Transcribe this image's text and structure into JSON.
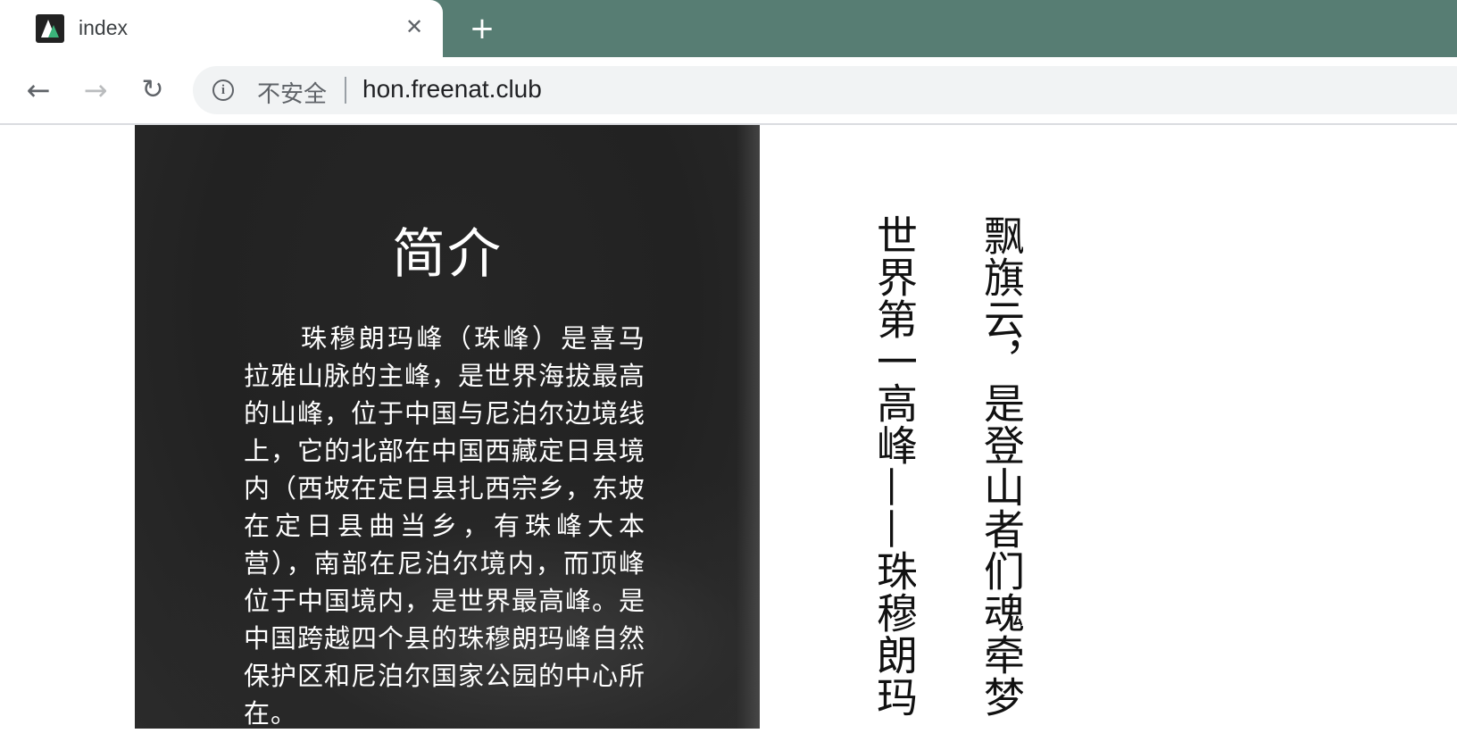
{
  "browser": {
    "tab_title": "index",
    "tab_close": "✕",
    "new_tab": "+",
    "back": "←",
    "forward": "→",
    "reload": "↻",
    "security_label": "不安全",
    "url": "hon.freenat.club",
    "accent_color": "#577d73"
  },
  "intro": {
    "title": "简介",
    "paragraph": "珠穆朗玛峰（珠峰）是喜马拉雅山脉的主峰，是世界海拔最高的山峰，位于中国与尼泊尔边境线上，它的北部在中国西藏定日县境内（西坡在定日县扎西宗乡，东坡在定日县曲当乡，有珠峰大本营），南部在尼泊尔境内，而顶峰位于中国境内，是世界最高峰。是中国跨越四个县的珠穆朗玛峰自然保护区和尼泊尔国家公园的中心所在。"
  },
  "poem": {
    "column_1": "飘旗云，是登山者们魂牵梦",
    "column_2": "世界第一高峰——珠穆朗玛"
  }
}
